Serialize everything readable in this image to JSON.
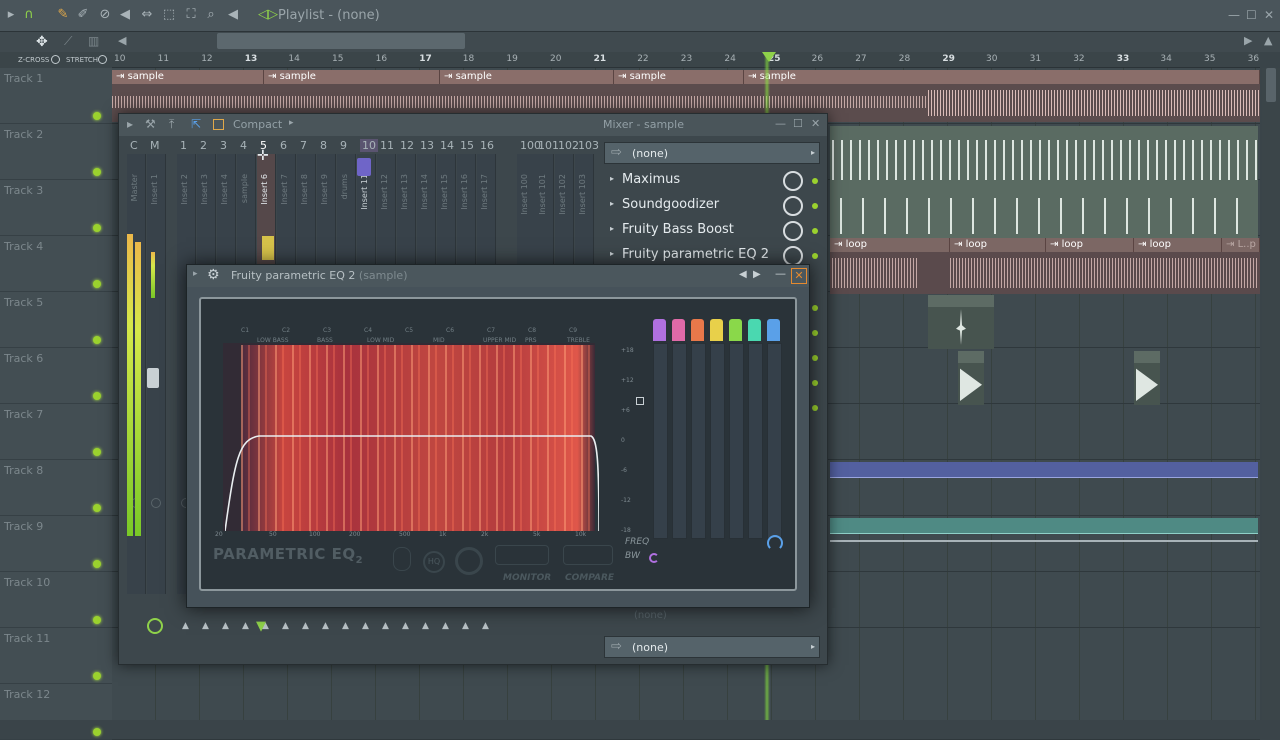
{
  "toolbar": {
    "title": "Playlist - (none)",
    "icons": [
      "magnet-icon",
      "pencil-icon",
      "paint-icon",
      "delete-icon",
      "mute-icon",
      "slip-icon",
      "select-icon",
      "zoom-icon",
      "playback-icon"
    ]
  },
  "timeline": {
    "zcross_label": "Z-CROSS",
    "stretch_label": "STRETCH",
    "markers": [
      "10",
      "11",
      "12",
      "13",
      "14",
      "15",
      "16",
      "17",
      "18",
      "19",
      "20",
      "21",
      "22",
      "23",
      "24",
      "25",
      "26",
      "27",
      "28",
      "29",
      "30",
      "31",
      "32",
      "33",
      "34",
      "35",
      "36"
    ],
    "bold_markers": [
      "13",
      "17",
      "21",
      "25",
      "29",
      "33"
    ]
  },
  "tracks": [
    "Track 1",
    "Track 2",
    "Track 3",
    "Track 4",
    "Track 5",
    "Track 6",
    "Track 7",
    "Track 8",
    "Track 9",
    "Track 10",
    "Track 11",
    "Track 12"
  ],
  "clips": {
    "sample_label": "sample",
    "loop_label": "loop",
    "loop_trunc_label": "L..p"
  },
  "mixer": {
    "title": "Mixer - sample",
    "compact_label": "Compact",
    "headers": [
      "C",
      "M",
      "1",
      "2",
      "3",
      "4",
      "5",
      "6",
      "7",
      "8",
      "9",
      "10",
      "11",
      "12",
      "13",
      "14",
      "15",
      "16",
      "100",
      "101",
      "102",
      "103"
    ],
    "insert_labels": [
      "Master",
      "Insert 1",
      "Insert 2",
      "Insert 3",
      "Insert 4",
      "sample",
      "Insert 6",
      "Insert 7",
      "Insert 8",
      "Insert 9",
      "drums",
      "Insert 11",
      "Insert 12",
      "Insert 13",
      "Insert 14",
      "Insert 15",
      "Insert 16",
      "Insert 17",
      "Insert 100",
      "Insert 101",
      "Insert 102",
      "Insert 103"
    ],
    "input_select": "(none)",
    "output_select": "(none)",
    "slot_faded": "(none)",
    "slots": [
      "Maximus",
      "Soundgoodizer",
      "Fruity Bass Boost",
      "Fruity parametric EQ 2"
    ]
  },
  "eq": {
    "title": "Fruity parametric EQ 2",
    "title_suffix": "(sample)",
    "octaves": [
      "C1",
      "C2",
      "C3",
      "C4",
      "C5",
      "C6",
      "C7",
      "C8",
      "C9"
    ],
    "ranges": [
      "LOW BASS",
      "BASS",
      "LOW MID",
      "MID",
      "UPPER MID",
      "PRS",
      "TREBLE"
    ],
    "freqs": [
      "20",
      "50",
      "100",
      "200",
      "500",
      "1k",
      "2k",
      "5k",
      "10k"
    ],
    "db_marks": [
      "+18",
      "+12",
      "+6",
      "0",
      "-6",
      "-12",
      "-18"
    ],
    "brand": "PARAMETRIC EQ",
    "brand_sub": "2",
    "hq_label": "HQ",
    "monitor_label": "MONITOR",
    "compare_label": "COMPARE",
    "freq_label": "FREQ",
    "bw_label": "BW",
    "band_colors": [
      "#b070e0",
      "#e06aa8",
      "#e8784a",
      "#e8d04a",
      "#8ad84a",
      "#4ad8b0",
      "#5aa0e8"
    ],
    "colors": {
      "accent": "#e58a2f",
      "led": "#9bd22e"
    }
  }
}
